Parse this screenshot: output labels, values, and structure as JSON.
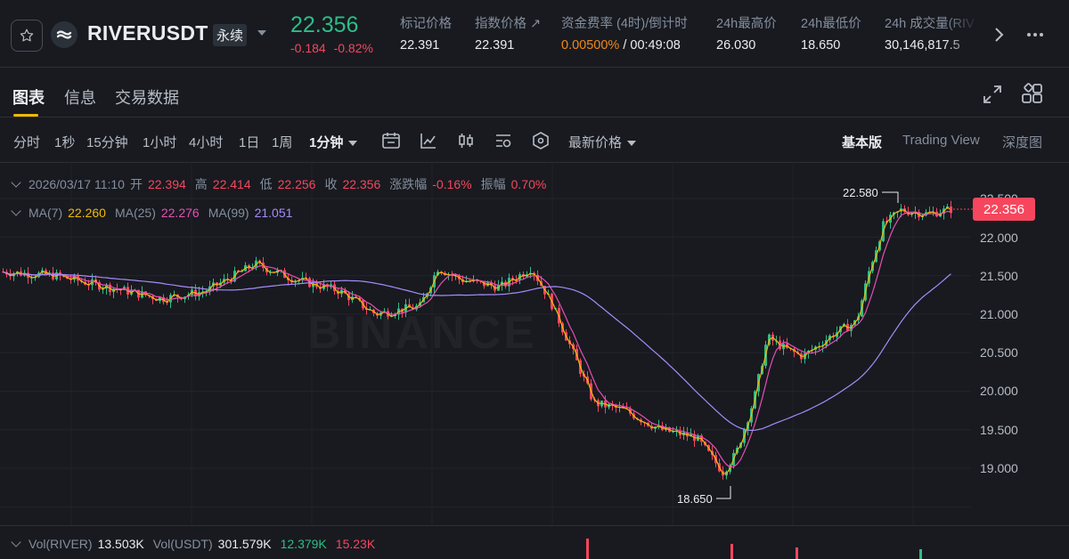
{
  "header": {
    "symbol": "RIVERUSDT",
    "contract_type": "永续",
    "last_price": "22.356",
    "change_abs": "-0.184",
    "change_pct": "-0.82%",
    "colors": {
      "up": "#2ebd85",
      "down": "#f6465d",
      "accent": "#f0b90b"
    },
    "stats": [
      {
        "label": "标记价格",
        "value": "22.391"
      },
      {
        "label": "指数价格 ↗",
        "value": "22.391"
      },
      {
        "label": "资金费率 (4时)/倒计时",
        "value_rate": "0.00500%",
        "value_countdown": " / 00:49:08"
      },
      {
        "label": "24h最高价",
        "value": "26.030"
      },
      {
        "label": "24h最低价",
        "value": "18.650"
      },
      {
        "label": "24h 成交量(RIV",
        "value": "30,146,817.5"
      }
    ]
  },
  "tabs": [
    "图表",
    "信息",
    "交易数据"
  ],
  "toolbar": {
    "intervals": [
      "分时",
      "1秒",
      "15分钟",
      "1小时",
      "4小时",
      "1日",
      "1周"
    ],
    "selected_interval": "1分钟",
    "price_type": "最新价格",
    "views": [
      "基本版",
      "Trading View",
      "深度图"
    ],
    "icons": [
      "replay-icon",
      "indicator-icon",
      "candle-style-icon",
      "settings-icon",
      "hex-icon"
    ]
  },
  "ohlc": {
    "datetime": "2026/03/17 11:10",
    "open_label": "开",
    "open": "22.394",
    "high_label": "高",
    "high": "22.414",
    "low_label": "低",
    "low": "22.256",
    "close_label": "收",
    "close": "22.356",
    "change_label": "涨跌幅",
    "change": "-0.16%",
    "amp_label": "振幅",
    "amp": "0.70%"
  },
  "ma": [
    {
      "label": "MA(7)",
      "value": "22.260",
      "color": "#f0b90b"
    },
    {
      "label": "MA(25)",
      "value": "22.276",
      "color": "#e84eb3"
    },
    {
      "label": "MA(99)",
      "value": "21.051",
      "color": "#a78bfa"
    }
  ],
  "price_axis": [
    "22.500",
    "22.000",
    "21.500",
    "21.000",
    "20.500",
    "20.000",
    "19.500",
    "19.000"
  ],
  "current_price_tag": "22.356",
  "high_marker": "22.580",
  "low_marker": "18.650",
  "watermark": "BINANCE",
  "volume": {
    "label1": "Vol(RIVER)",
    "value1": "13.503K",
    "label2": "Vol(USDT)",
    "value2": "301.579K",
    "ma1": "12.379K",
    "ma2": "15.23K"
  }
}
